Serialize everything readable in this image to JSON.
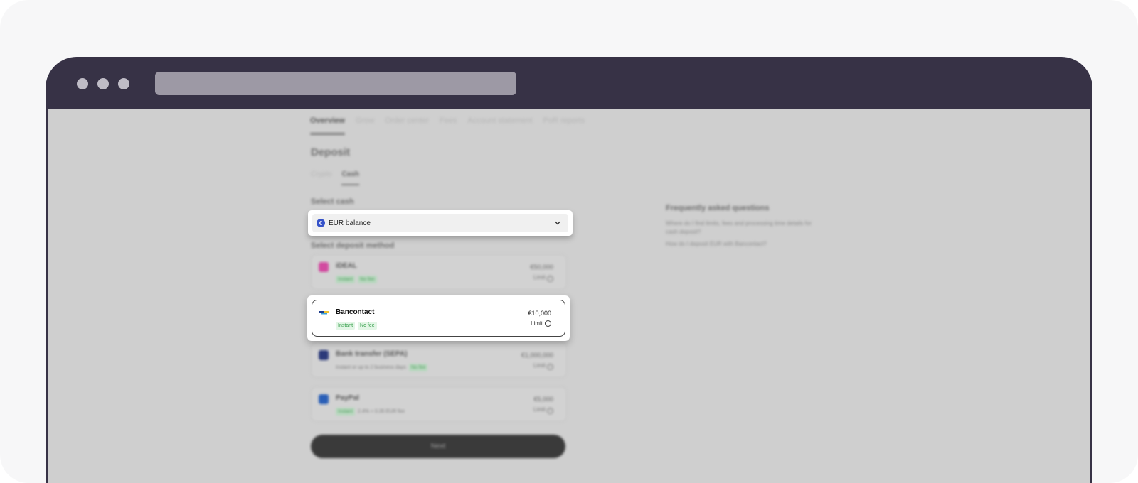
{
  "nav": {
    "tabs": [
      "Overview",
      "Grow",
      "Order center",
      "Fees",
      "Account statement",
      "PoR reports"
    ]
  },
  "page": {
    "title": "Deposit",
    "subtabs": [
      "Crypto",
      "Cash"
    ]
  },
  "select_cash": {
    "label": "Select cash",
    "value": "EUR balance",
    "icon": "euro-icon",
    "icon_glyph": "€"
  },
  "deposit": {
    "label": "Select deposit method",
    "methods": [
      {
        "name": "iDEAL",
        "tags": [
          "Instant",
          "No fee"
        ],
        "amount": "€50,000",
        "limit": "Limit",
        "icon_color": "#d24ba0"
      },
      {
        "name": "Bancontact",
        "tags": [
          "Instant",
          "No fee"
        ],
        "amount": "€10,000",
        "limit": "Limit",
        "icon_color": "#1e3c8c"
      },
      {
        "name": "Bank transfer (SEPA)",
        "note": "Instant or up to 2 business days",
        "tags": [
          "No fee"
        ],
        "amount": "€1,000,000",
        "limit": "Limit",
        "icon_color": "#2c3a7a"
      },
      {
        "name": "PayPal",
        "tags": [
          "Instant"
        ],
        "note": "2.4% + 0.35 EUR fee",
        "amount": "€5,000",
        "limit": "Limit",
        "icon_color": "#2a5fb7"
      }
    ]
  },
  "next_label": "Next",
  "faq": {
    "title": "Frequently asked questions",
    "questions": [
      "Where do I find limits, fees and processing time details for cash deposit?",
      "How do I deposit EUR with Bancontact?"
    ]
  },
  "colors": {
    "browser_chrome": "#373246",
    "accent_green": "#2d9a44",
    "euro_blue": "#3653c9"
  }
}
